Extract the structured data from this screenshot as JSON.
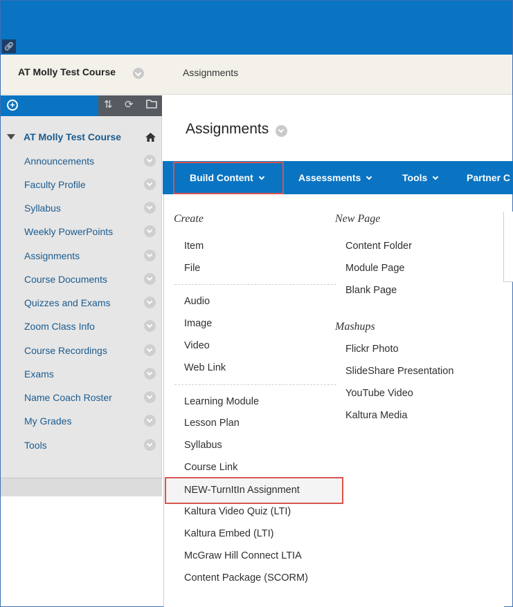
{
  "breadcrumb": {
    "course": "AT Molly Test Course",
    "page": "Assignments"
  },
  "sidebar": {
    "course_title": "AT Molly Test Course",
    "items": [
      {
        "label": "Announcements"
      },
      {
        "label": "Faculty Profile"
      },
      {
        "label": "Syllabus"
      },
      {
        "label": "Weekly PowerPoints"
      },
      {
        "label": "Assignments"
      },
      {
        "label": "Course Documents"
      },
      {
        "label": "Quizzes and Exams"
      },
      {
        "label": "Zoom Class Info"
      },
      {
        "label": "Course Recordings"
      },
      {
        "label": "Exams"
      },
      {
        "label": "Name Coach Roster"
      },
      {
        "label": "My Grades"
      },
      {
        "label": "Tools"
      }
    ],
    "toolbar_icons": [
      "add-icon",
      "sort-icon",
      "refresh-icon",
      "folder-icon"
    ]
  },
  "content": {
    "title": "Assignments"
  },
  "action_bar": {
    "items": [
      {
        "label": "Build Content"
      },
      {
        "label": "Assessments"
      },
      {
        "label": "Tools"
      },
      {
        "label": "Partner C"
      }
    ]
  },
  "build_menu": {
    "create_heading": "Create",
    "create_group1": [
      {
        "label": "Item"
      },
      {
        "label": "File"
      }
    ],
    "create_group2": [
      {
        "label": "Audio"
      },
      {
        "label": "Image"
      },
      {
        "label": "Video"
      },
      {
        "label": "Web Link"
      }
    ],
    "create_group3": [
      {
        "label": "Learning Module"
      },
      {
        "label": "Lesson Plan"
      },
      {
        "label": "Syllabus"
      },
      {
        "label": "Course Link"
      },
      {
        "label": "NEW-TurnItIn Assignment"
      },
      {
        "label": "Kaltura Video Quiz (LTI)"
      },
      {
        "label": "Kaltura Embed (LTI)"
      },
      {
        "label": "McGraw Hill Connect LTIA"
      },
      {
        "label": "Content Package (SCORM)"
      }
    ],
    "newpage_heading": "New Page",
    "newpage_items": [
      {
        "label": "Content Folder"
      },
      {
        "label": "Module Page"
      },
      {
        "label": "Blank Page"
      }
    ],
    "mashups_heading": "Mashups",
    "mashups_items": [
      {
        "label": "Flickr Photo"
      },
      {
        "label": "SlideShare Presentation"
      },
      {
        "label": "YouTube Video"
      },
      {
        "label": "Kaltura Media"
      }
    ]
  },
  "colors": {
    "brand_blue": "#0a74c2",
    "highlight_red": "#d9534f",
    "link_blue": "#1a5b8f"
  }
}
